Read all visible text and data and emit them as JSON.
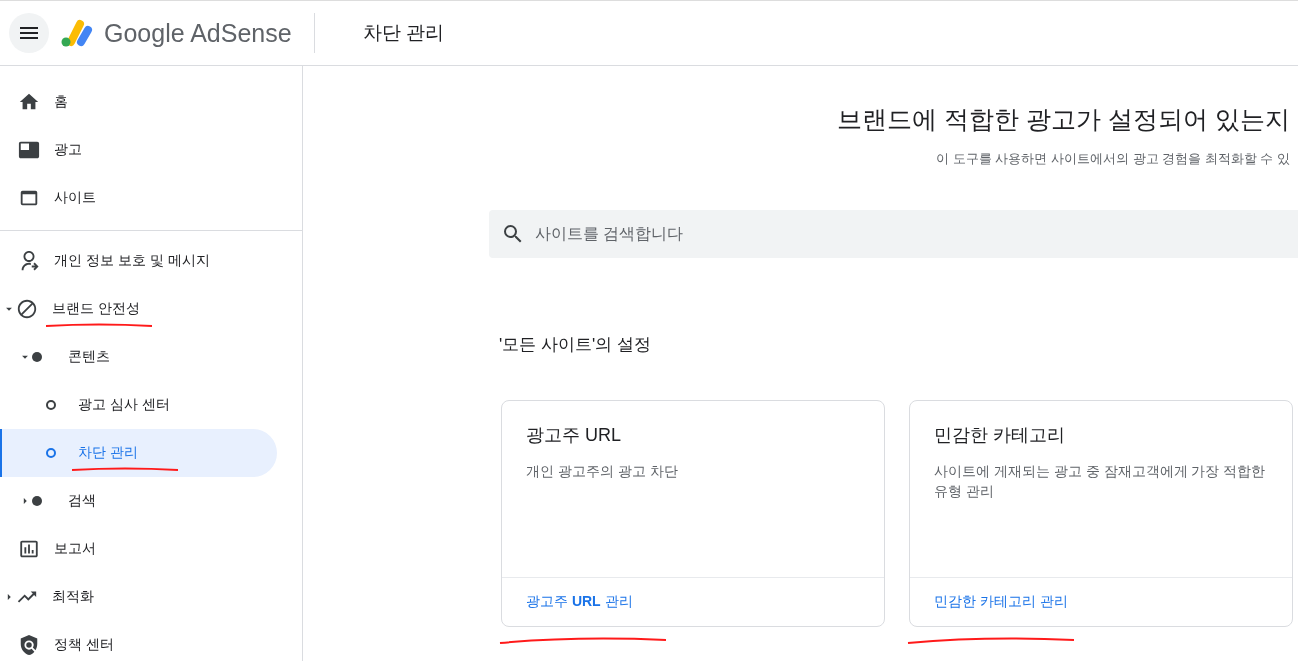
{
  "header": {
    "product": "Google AdSense",
    "page_title": "차단 관리"
  },
  "sidebar": {
    "sections": [
      {
        "items": [
          {
            "label": "홈",
            "selected": false
          },
          {
            "label": "광고",
            "selected": false
          },
          {
            "label": "사이트",
            "selected": false
          }
        ]
      },
      {
        "items": [
          {
            "label": "개인 정보 보호 및 메시지",
            "selected": false
          },
          {
            "label": "브랜드 안전성",
            "selected": false,
            "expanded": true,
            "annotated": true,
            "children": [
              {
                "label": "콘텐츠",
                "selected": false,
                "expanded": true,
                "children": [
                  {
                    "label": "광고 심사 센터",
                    "selected": false
                  },
                  {
                    "label": "차단 관리",
                    "selected": true,
                    "annotated": true
                  }
                ]
              },
              {
                "label": "검색",
                "selected": false,
                "expanded": false
              }
            ]
          },
          {
            "label": "보고서",
            "selected": false
          },
          {
            "label": "최적화",
            "selected": false,
            "expanded": false
          },
          {
            "label": "정책 센터",
            "selected": false
          }
        ]
      }
    ]
  },
  "main": {
    "heading": "브랜드에 적합한 광고가 설정되어 있는지",
    "subheading": "이 도구를 사용하면 사이트에서의 광고 경험을 최적화할 수 있",
    "search": {
      "placeholder": "사이트를 검색합니다"
    },
    "settings_title": "'모든 사이트'의 설정",
    "cards": [
      {
        "title": "광고주 URL",
        "description": "개인 광고주의 광고 차단",
        "link": "광고주 **URL** 관리",
        "annotated": true
      },
      {
        "title": "민감한 카테고리",
        "description": "사이트에 게재되는 광고 중 잠재고객에게 가장 적합한 유형 관리",
        "link": "민감한 카테고리 관리",
        "annotated": true
      }
    ]
  }
}
